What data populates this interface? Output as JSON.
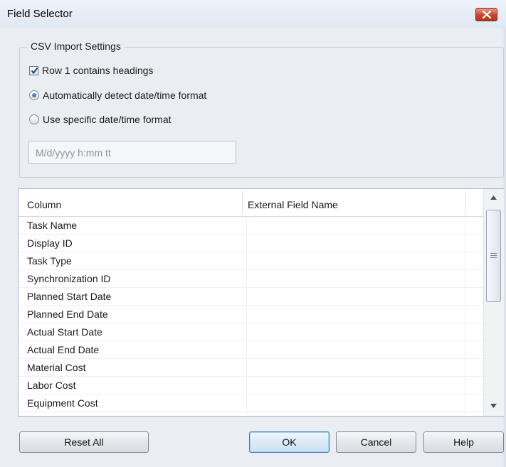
{
  "window": {
    "title": "Field Selector",
    "close_label": "×"
  },
  "csv_settings": {
    "legend": "CSV Import Settings",
    "row1_headings": {
      "label": "Row 1 contains headings",
      "checked": true
    },
    "auto_detect": {
      "label": "Automatically detect date/time format",
      "selected": true
    },
    "specific_format": {
      "label": "Use specific date/time format",
      "selected": false
    },
    "format_input": {
      "value": "M/d/yyyy h:mm tt"
    }
  },
  "grid": {
    "headers": {
      "column": "Column",
      "external": "External Field Name"
    },
    "rows": [
      "Task Name",
      "Display ID",
      "Task Type",
      "Synchronization ID",
      "Planned Start Date",
      "Planned End Date",
      "Actual Start Date",
      "Actual End Date",
      "Material Cost",
      "Labor Cost",
      "Equipment Cost"
    ]
  },
  "buttons": {
    "reset_all": "Reset All",
    "ok": "OK",
    "cancel": "Cancel",
    "help": "Help"
  },
  "icons": {
    "close": "close-icon",
    "checkmark": "checkmark-icon",
    "scroll_up": "arrow-up-icon",
    "scroll_down": "arrow-down-icon",
    "grip": "grip-icon"
  }
}
